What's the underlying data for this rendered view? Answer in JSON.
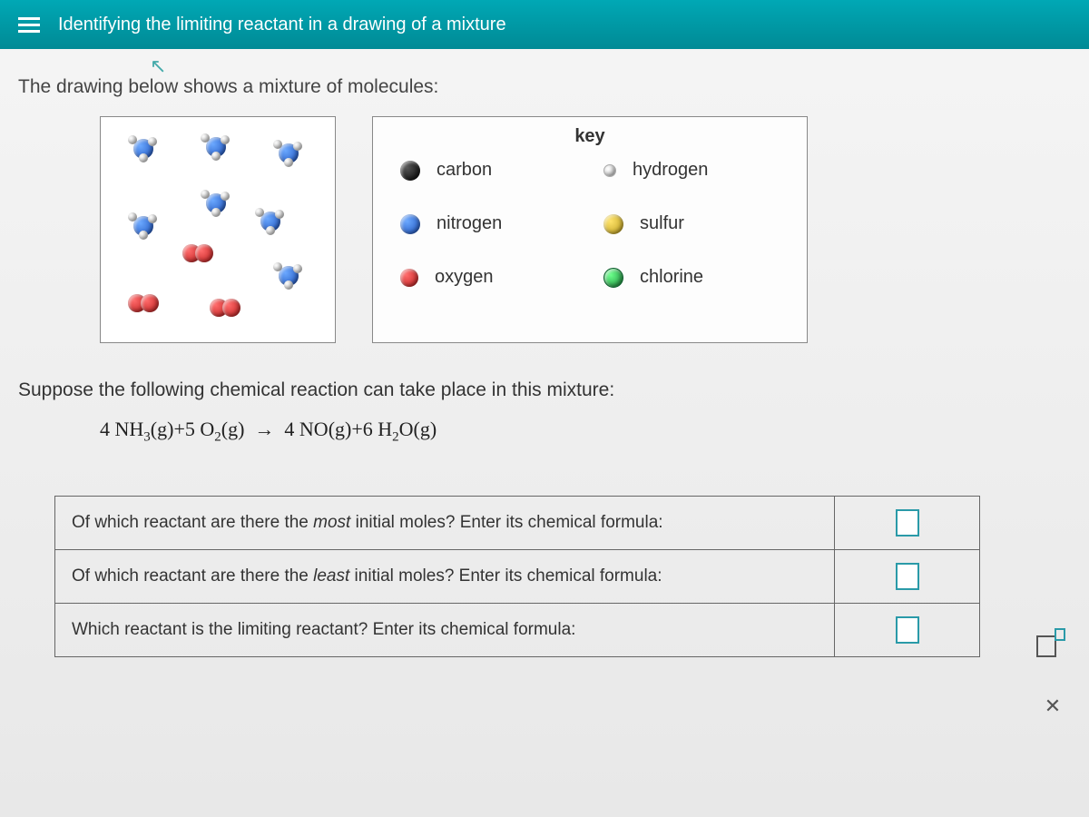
{
  "header": {
    "title": "Identifying the limiting reactant in a drawing of a mixture"
  },
  "intro": "The drawing below shows a mixture of molecules:",
  "key": {
    "title": "key",
    "items": [
      {
        "label": "carbon"
      },
      {
        "label": "hydrogen"
      },
      {
        "label": "nitrogen"
      },
      {
        "label": "sulfur"
      },
      {
        "label": "oxygen"
      },
      {
        "label": "chlorine"
      }
    ]
  },
  "suppose": "Suppose the following chemical reaction can take place in this mixture:",
  "equation": {
    "lhs1_coef": "4",
    "lhs1_base": "NH",
    "lhs1_sub": "3",
    "lhs1_state": "(g)",
    "plus": "+",
    "lhs2_coef": "5",
    "lhs2_base": "O",
    "lhs2_sub": "2",
    "lhs2_state": "(g)",
    "arrow": "→",
    "rhs1_coef": "4",
    "rhs1_base": "NO",
    "rhs1_state": "(g)",
    "rhs2_coef": "6",
    "rhs2_base": "H",
    "rhs2_sub": "2",
    "rhs2_base2": "O",
    "rhs2_state": "(g)"
  },
  "questions": [
    {
      "prefix": "Of which reactant are there the ",
      "em": "most",
      "suffix": " initial moles? Enter its chemical formula:"
    },
    {
      "prefix": "Of which reactant are there the ",
      "em": "least",
      "suffix": " initial moles? Enter its chemical formula:"
    },
    {
      "prefix": "Which reactant is the limiting reactant? Enter its chemical formula:",
      "em": "",
      "suffix": ""
    }
  ],
  "tools": {
    "close": "✕"
  }
}
